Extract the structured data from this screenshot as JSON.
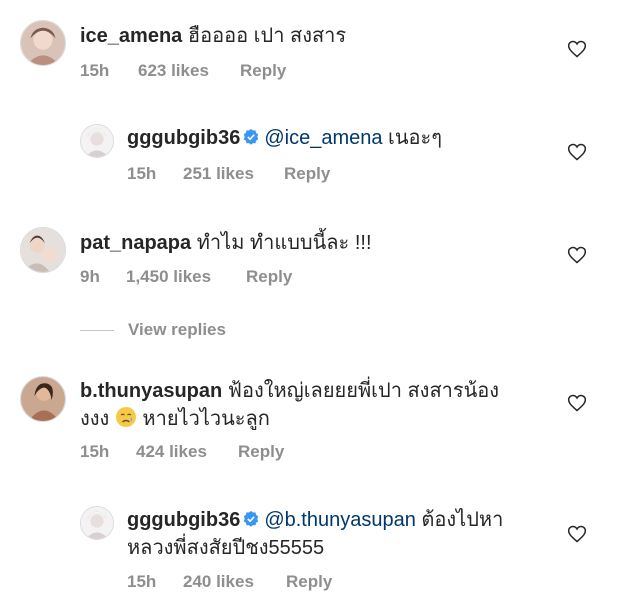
{
  "comments": [
    {
      "username": "ice_amena",
      "text": "ฮืออออ เปา สงสาร",
      "time": "15h",
      "likes": "623 likes",
      "reply": "Reply"
    },
    {
      "username": "gggubgib36",
      "mention": "@ice_amena",
      "text": " เนอะๆ",
      "time": "15h",
      "likes": "251 likes",
      "reply": "Reply"
    },
    {
      "username": "pat_napapa",
      "text": "ทำไม ทำแบบนี้ละ !!!",
      "time": "9h",
      "likes": "1,450 likes",
      "reply": "Reply"
    },
    {
      "username": "b.thunyasupan",
      "text": "ฟ้องใหญ่เลยยยพี่เปา สงสารน้อง",
      "text_line2_a": "งงง",
      "text_line2_b": "หายไวไวนะลูก",
      "time": "15h",
      "likes": "424 likes",
      "reply": "Reply"
    },
    {
      "username": "gggubgib36",
      "mention": "@b.thunyasupan",
      "text": " ต้องไปหา",
      "text_line2": "หลวงพี่สงสัยปีชง55555",
      "time": "15h",
      "likes": "240 likes",
      "reply": "Reply"
    }
  ],
  "view_replies": "View replies",
  "colors": {
    "text": "#262626",
    "meta": "#8e8e8e",
    "mention": "#00376b",
    "verified": "#3897f0"
  },
  "icons": {
    "heart": "heart-outline-icon",
    "verified": "verified-badge-icon",
    "emoji": "crying-face-icon"
  }
}
